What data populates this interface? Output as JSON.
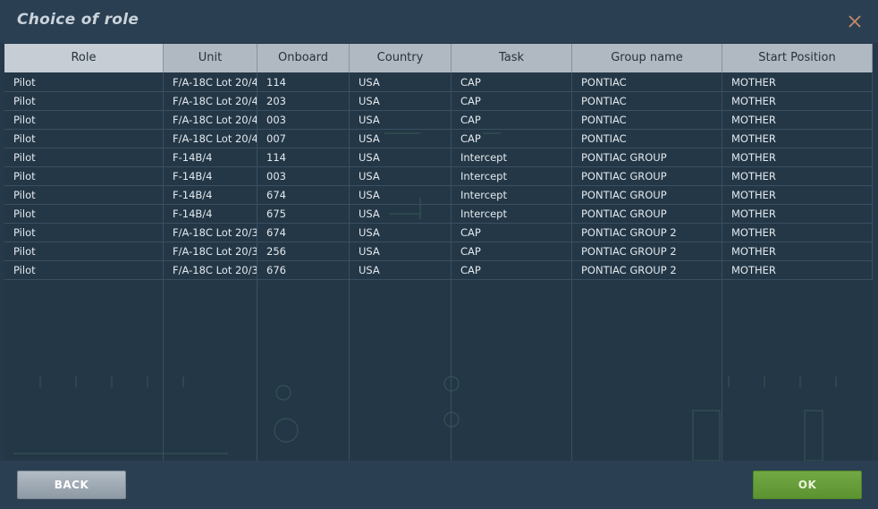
{
  "window": {
    "title": "Choice of role"
  },
  "columns": [
    {
      "key": "role",
      "label": "Role"
    },
    {
      "key": "unit",
      "label": "Unit"
    },
    {
      "key": "onboard",
      "label": "Onboard"
    },
    {
      "key": "country",
      "label": "Country"
    },
    {
      "key": "task",
      "label": "Task"
    },
    {
      "key": "group",
      "label": "Group name"
    },
    {
      "key": "start",
      "label": "Start Position"
    }
  ],
  "rows": [
    {
      "role": "Pilot",
      "unit": "F/A-18C Lot 20/4",
      "onboard": "114",
      "country": "USA",
      "task": "CAP",
      "group": "PONTIAC",
      "start": "MOTHER"
    },
    {
      "role": "Pilot",
      "unit": "F/A-18C Lot 20/4",
      "onboard": "203",
      "country": "USA",
      "task": "CAP",
      "group": "PONTIAC",
      "start": "MOTHER"
    },
    {
      "role": "Pilot",
      "unit": "F/A-18C Lot 20/4",
      "onboard": "003",
      "country": "USA",
      "task": "CAP",
      "group": "PONTIAC",
      "start": "MOTHER"
    },
    {
      "role": "Pilot",
      "unit": "F/A-18C Lot 20/4",
      "onboard": "007",
      "country": "USA",
      "task": "CAP",
      "group": "PONTIAC",
      "start": "MOTHER"
    },
    {
      "role": "Pilot",
      "unit": "F-14B/4",
      "onboard": "114",
      "country": "USA",
      "task": "Intercept",
      "group": "PONTIAC GROUP",
      "start": "MOTHER"
    },
    {
      "role": "Pilot",
      "unit": "F-14B/4",
      "onboard": "003",
      "country": "USA",
      "task": "Intercept",
      "group": "PONTIAC GROUP",
      "start": "MOTHER"
    },
    {
      "role": "Pilot",
      "unit": "F-14B/4",
      "onboard": "674",
      "country": "USA",
      "task": "Intercept",
      "group": "PONTIAC GROUP",
      "start": "MOTHER"
    },
    {
      "role": "Pilot",
      "unit": "F-14B/4",
      "onboard": "675",
      "country": "USA",
      "task": "Intercept",
      "group": "PONTIAC GROUP",
      "start": "MOTHER"
    },
    {
      "role": "Pilot",
      "unit": "F/A-18C Lot 20/3",
      "onboard": "674",
      "country": "USA",
      "task": "CAP",
      "group": "PONTIAC GROUP 2",
      "start": "MOTHER"
    },
    {
      "role": "Pilot",
      "unit": "F/A-18C Lot 20/3",
      "onboard": "256",
      "country": "USA",
      "task": "CAP",
      "group": "PONTIAC GROUP 2",
      "start": "MOTHER"
    },
    {
      "role": "Pilot",
      "unit": "F/A-18C Lot 20/3",
      "onboard": "676",
      "country": "USA",
      "task": "CAP",
      "group": "PONTIAC GROUP 2",
      "start": "MOTHER"
    }
  ],
  "footer": {
    "back_label": "BACK",
    "ok_label": "OK"
  },
  "icons": {
    "close": "close-icon"
  },
  "colors": {
    "accent_ok": "#5c9331",
    "close_icon": "#c58b6a",
    "header_bg": "#b0b9c2"
  }
}
